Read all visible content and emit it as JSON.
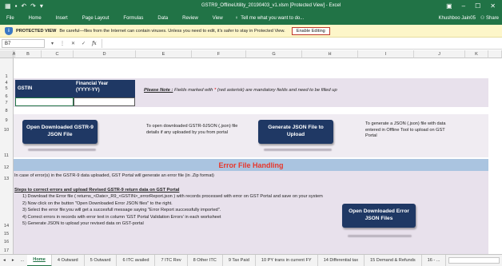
{
  "window": {
    "title": "GSTR9_OfflineUtility_20190403_v1.xlsm [Protected View] - Excel",
    "save_icon": "save-icon",
    "undo_icon": "undo-icon",
    "redo_icon": "redo-icon"
  },
  "ribbon": {
    "tabs": [
      "File",
      "Home",
      "Insert",
      "Page Layout",
      "Formulas",
      "Data",
      "Review",
      "View"
    ],
    "tellme": "Tell me what you want to do...",
    "user": "Khushboo Jain05",
    "share": "Share"
  },
  "protected_view": {
    "label": "PROTECTED VIEW",
    "message": "Be careful—files from the Internet can contain viruses. Unless you need to edit, it's safer to stay in Protected View.",
    "button": "Enable Editing"
  },
  "formula_bar": {
    "cell_ref": "B7",
    "cancel": "✕",
    "confirm": "✓",
    "fx": "fx"
  },
  "columns": [
    "A",
    "B",
    "C",
    "D",
    "E",
    "F",
    "G",
    "H",
    "I",
    "J",
    "K"
  ],
  "rows": [
    "1",
    "4",
    "5",
    "6",
    "7",
    "8",
    "9",
    "10",
    "11",
    "12",
    "13",
    "14",
    "15",
    "16",
    "17"
  ],
  "sheet": {
    "gstin_header": "GSTIN",
    "fy_header": "Financial Year\n(YYYY-YY)",
    "note_label": "Please Note :",
    "note_text_1": " Fields marked with ",
    "note_star": "*",
    "note_text_2": " (red asterisk) are mandatory fields and need to be filled up",
    "btn_open_gstr9": "Open Downloaded GSTR-9\nJSON File",
    "desc_open_gstr9": "To open downloaded GSTR-9JSON (.json) file\ndetails if any uploaded by you from portal",
    "btn_generate_json": "Generate JSON File to\nUpload",
    "desc_generate_json": "To generate a JSON (.json) file with data\nentered in Offline Tool to upload on GST\nPortal",
    "error_title": "Error File Handling",
    "error_intro": "In case of error(s) in the GSTR-9 data uploaded, GST Portal will generate an error file (in .Zip format)",
    "steps_title": "Steps to correct errors and upload Revised GSTR-9 return data on GST Portal",
    "steps": [
      "1) Download the Error file  ( returns_<Date>_R9_<GSTIN>_errorReport.json ) with records processed with error on GST Portal and save on your system",
      "2) Now click on the button \"Open Downloaded Error JSON files\" to the right.",
      "3) Select the error file;you will get a succesfull message saying \"Error Report successfully imported\".",
      "4) Correct errors in records with error text in column 'GST Portal Validation Errors' in each worksheet",
      "5) Generate JSON to upload your revised data on GST-portal"
    ],
    "btn_open_error": "Open Downloaded Error\nJSON Files"
  },
  "sheet_tabs": [
    "Home",
    "4 Outward",
    "5 Outward",
    "6 ITC availed",
    "7 ITC Rev",
    "8 Other ITC",
    "9 Tax Paid",
    "10 PY trans in current FY",
    "14 Differential tax",
    "15 Demand & Refunds",
    "16 - ..."
  ],
  "sheet_nav": [
    "◂",
    "▸",
    "..."
  ],
  "active_tab": "Home"
}
